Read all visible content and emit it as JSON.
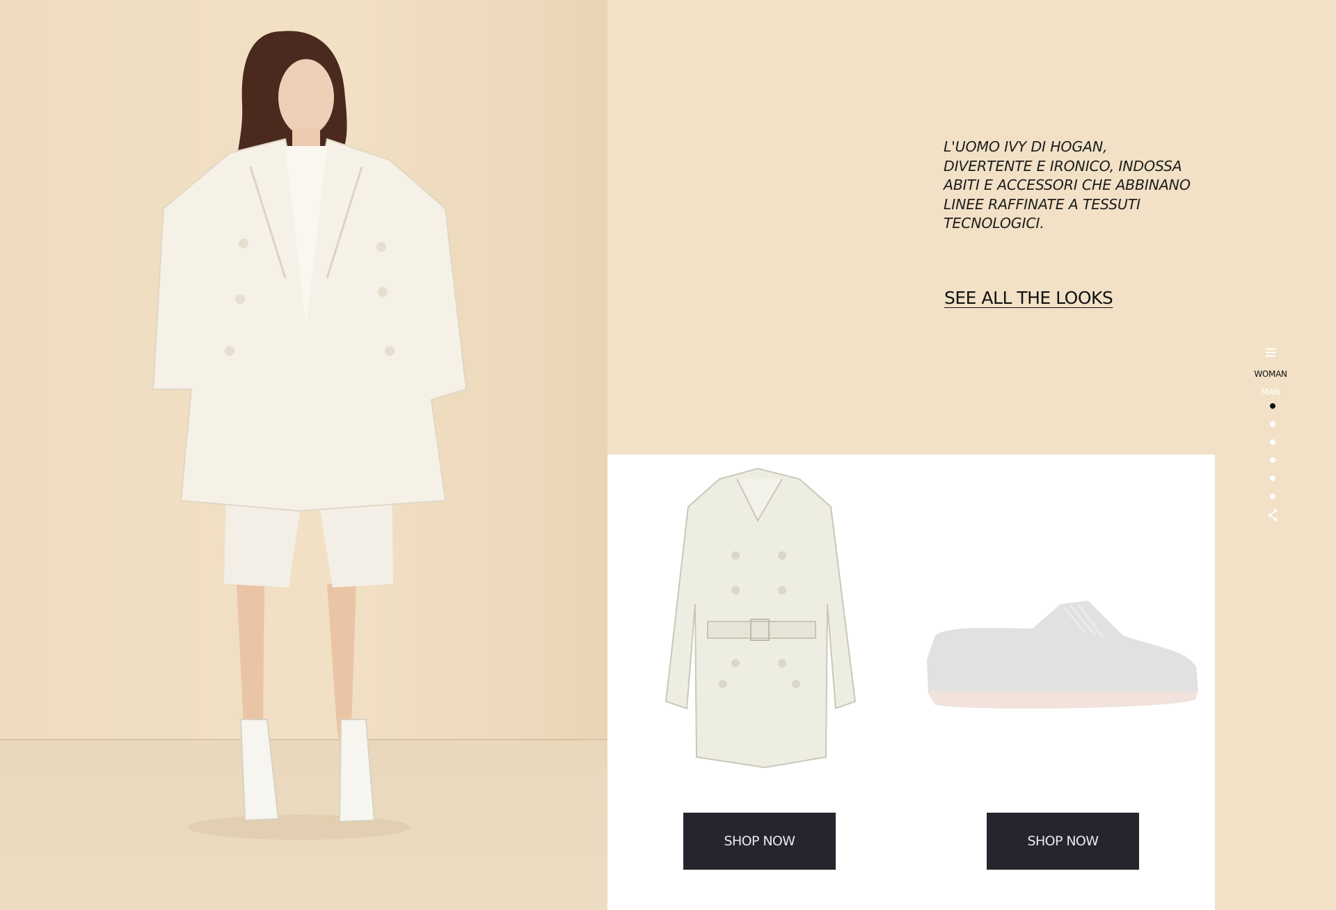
{
  "editorial": {
    "tagline_lines": [
      "L'UOMO IVY DI HOGAN,",
      "DIVERTENTE E IRONICO, INDOSSA",
      "ABITI E ACCESSORI CHE ABBINANO",
      "LINEE RAFFINATE A TESSUTI",
      "TECNOLOGICI."
    ],
    "see_all_label": "SEE ALL THE LOOKS"
  },
  "side_nav": {
    "items": [
      {
        "label": "WOMAN",
        "active": true
      },
      {
        "label": "MAN",
        "active": false
      }
    ],
    "slides_total": 6,
    "active_slide": 1,
    "menu_icon": "hamburger-icon",
    "share_icon": "share-icon"
  },
  "products": [
    {
      "image": "trench-coat-image",
      "button_label": "SHOP NOW"
    },
    {
      "image": "sneaker-shoe-image",
      "button_label": "SHOP NOW"
    }
  ],
  "colors": {
    "background": "#f2e1c6",
    "panel": "#ffffff",
    "button": "#25252d",
    "button_text": "#e9e9ee",
    "text": "#1d1d1d"
  }
}
